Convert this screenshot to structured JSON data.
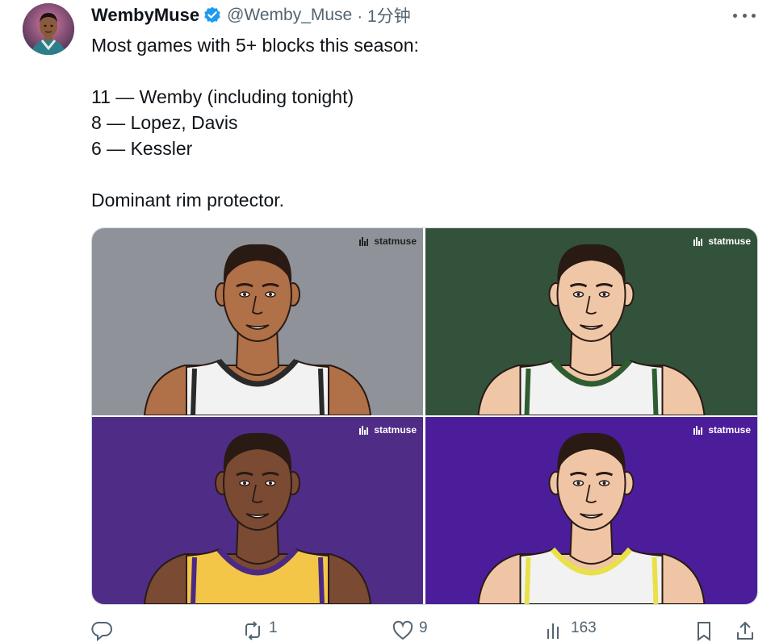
{
  "tweet": {
    "display_name": "WembyMuse",
    "handle": "@Wemby_Muse",
    "time": "· 1分钟",
    "lines": [
      "Most games with 5+ blocks this season:",
      "",
      "11 — Wemby (including tonight)",
      "8 — Lopez, Davis",
      "6 — Kessler",
      "",
      "Dominant rim protector."
    ]
  },
  "media": {
    "watermark": "statmuse",
    "tiles": [
      {
        "bg": "#8f9399",
        "jersey": "#f2f2f2",
        "trim": "#2a2a2a",
        "skin": "#b07048"
      },
      {
        "bg": "#33523b",
        "jersey": "#f2f2f2",
        "trim": "#2f5d31",
        "skin": "#efc7a7"
      },
      {
        "bg": "#4f2d86",
        "jersey": "#f3c648",
        "trim": "#4b2a84",
        "skin": "#7a4a33"
      },
      {
        "bg": "#4b1d9a",
        "jersey": "#f2f2f2",
        "trim": "#e9e04a",
        "skin": "#efc5a5"
      }
    ]
  },
  "actions": {
    "reply_count": "",
    "retweet_count": "1",
    "like_count": "9",
    "views_count": "163"
  },
  "icons": {
    "verified": "verified-badge-icon",
    "more": "more-options-icon",
    "reply": "reply-icon",
    "retweet": "retweet-icon",
    "like": "heart-icon",
    "views": "views-icon",
    "bookmark": "bookmark-icon",
    "share": "share-icon"
  },
  "colors": {
    "verified_blue": "#1d9bf0",
    "secondary_text": "#536471"
  }
}
